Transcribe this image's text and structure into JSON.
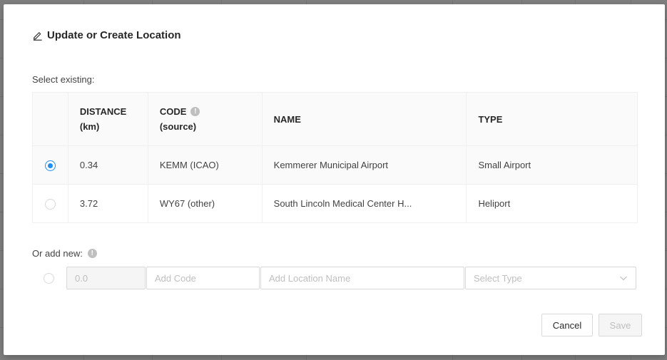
{
  "dialog": {
    "title": "Update or Create Location",
    "title_icon": "edit-icon"
  },
  "existing": {
    "label": "Select existing:",
    "columns": {
      "distance": "DISTANCE",
      "distance_unit": "(km)",
      "code": "CODE",
      "code_sub": "(source)",
      "name": "NAME",
      "type": "TYPE"
    },
    "rows": [
      {
        "selected": true,
        "distance": "0.34",
        "code": "KEMM (ICAO)",
        "name": "Kemmerer Municipal Airport",
        "type": "Small Airport"
      },
      {
        "selected": false,
        "distance": "3.72",
        "code": "WY67 (other)",
        "name": "South Lincoln Medical Center H...",
        "type": "Heliport"
      }
    ]
  },
  "add_new": {
    "label": "Or add new:",
    "distance_value": "0.0",
    "code_placeholder": "Add Code",
    "name_placeholder": "Add Location Name",
    "type_placeholder": "Select Type"
  },
  "buttons": {
    "cancel": "Cancel",
    "save": "Save"
  },
  "colors": {
    "primary": "#1890ff",
    "border": "#d9d9d9",
    "header_bg": "#fafafa"
  }
}
